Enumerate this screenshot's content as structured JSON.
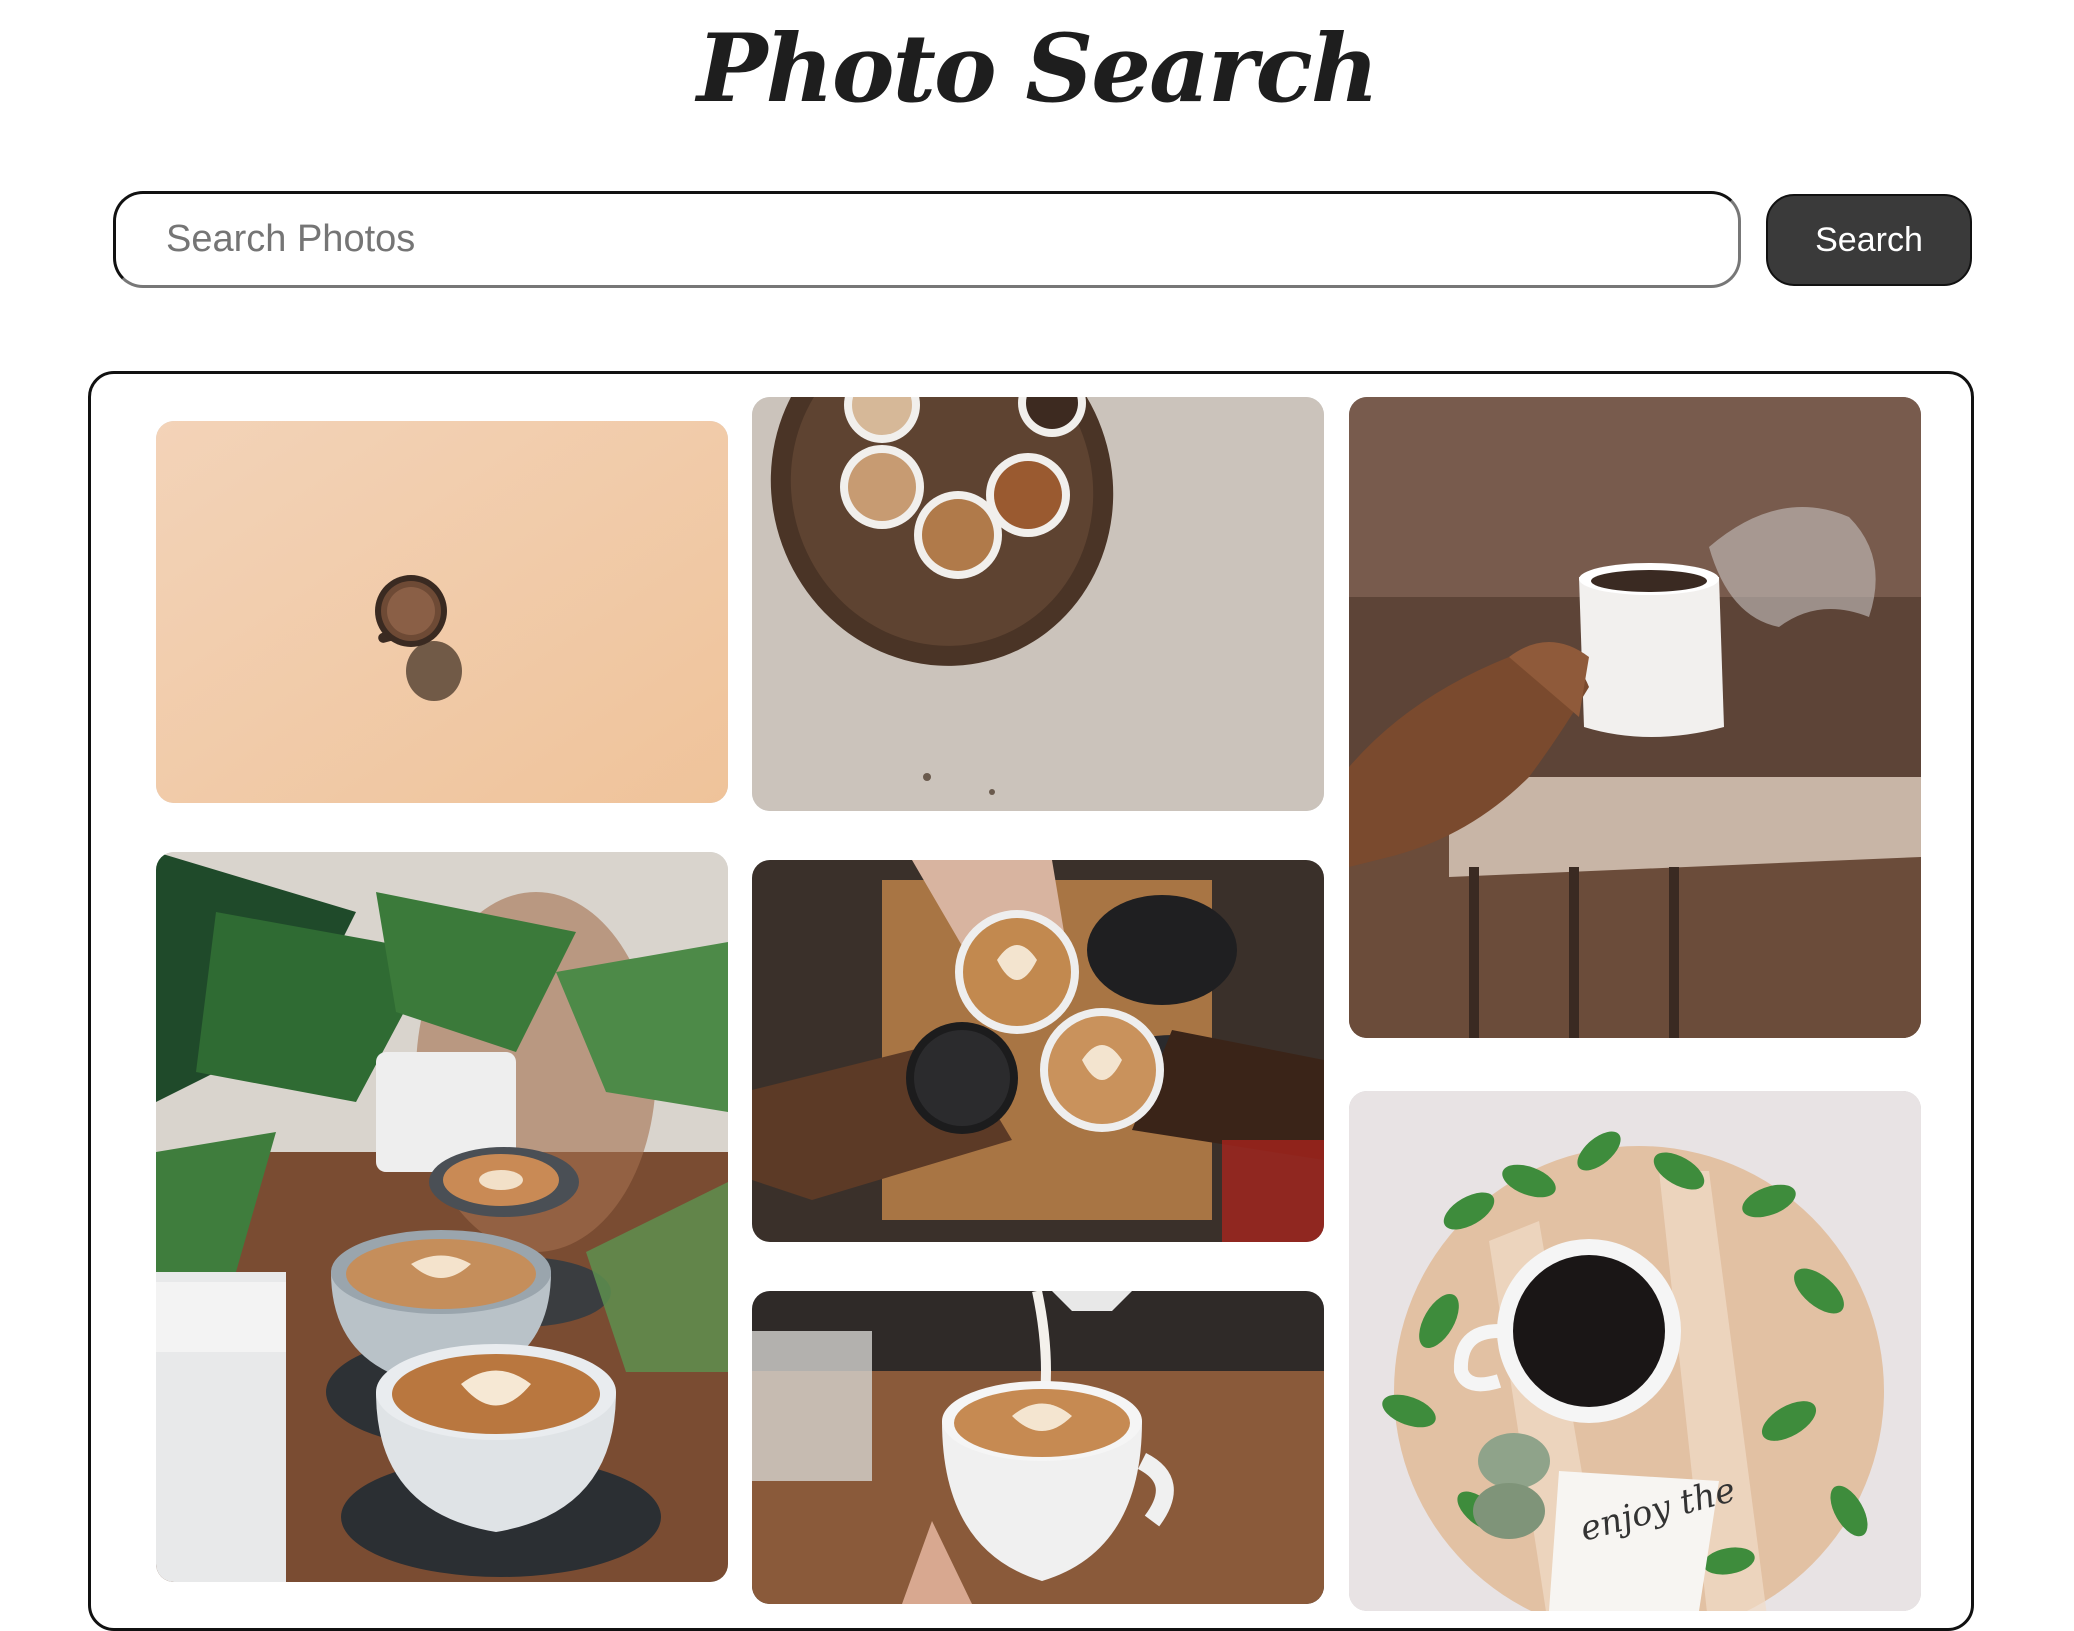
{
  "header": {
    "title": "Photo Search"
  },
  "search": {
    "placeholder": "Search Photos",
    "button_label": "Search"
  },
  "photos": [
    {
      "name": "coffee-cup-on-peach-background"
    },
    {
      "name": "coffee-cups-on-wooden-table-overhead"
    },
    {
      "name": "hand-holding-steaming-mug"
    },
    {
      "name": "latte-art-cups-with-plants"
    },
    {
      "name": "hands-toasting-coffee-cups"
    },
    {
      "name": "milk-pouring-latte-art"
    },
    {
      "name": "black-coffee-on-wooden-board-with-leaves",
      "card_text": "enjoy the"
    }
  ],
  "colors": {
    "accent": "#3a3a3a",
    "border": "#111111",
    "title": "#1e1e1e"
  }
}
